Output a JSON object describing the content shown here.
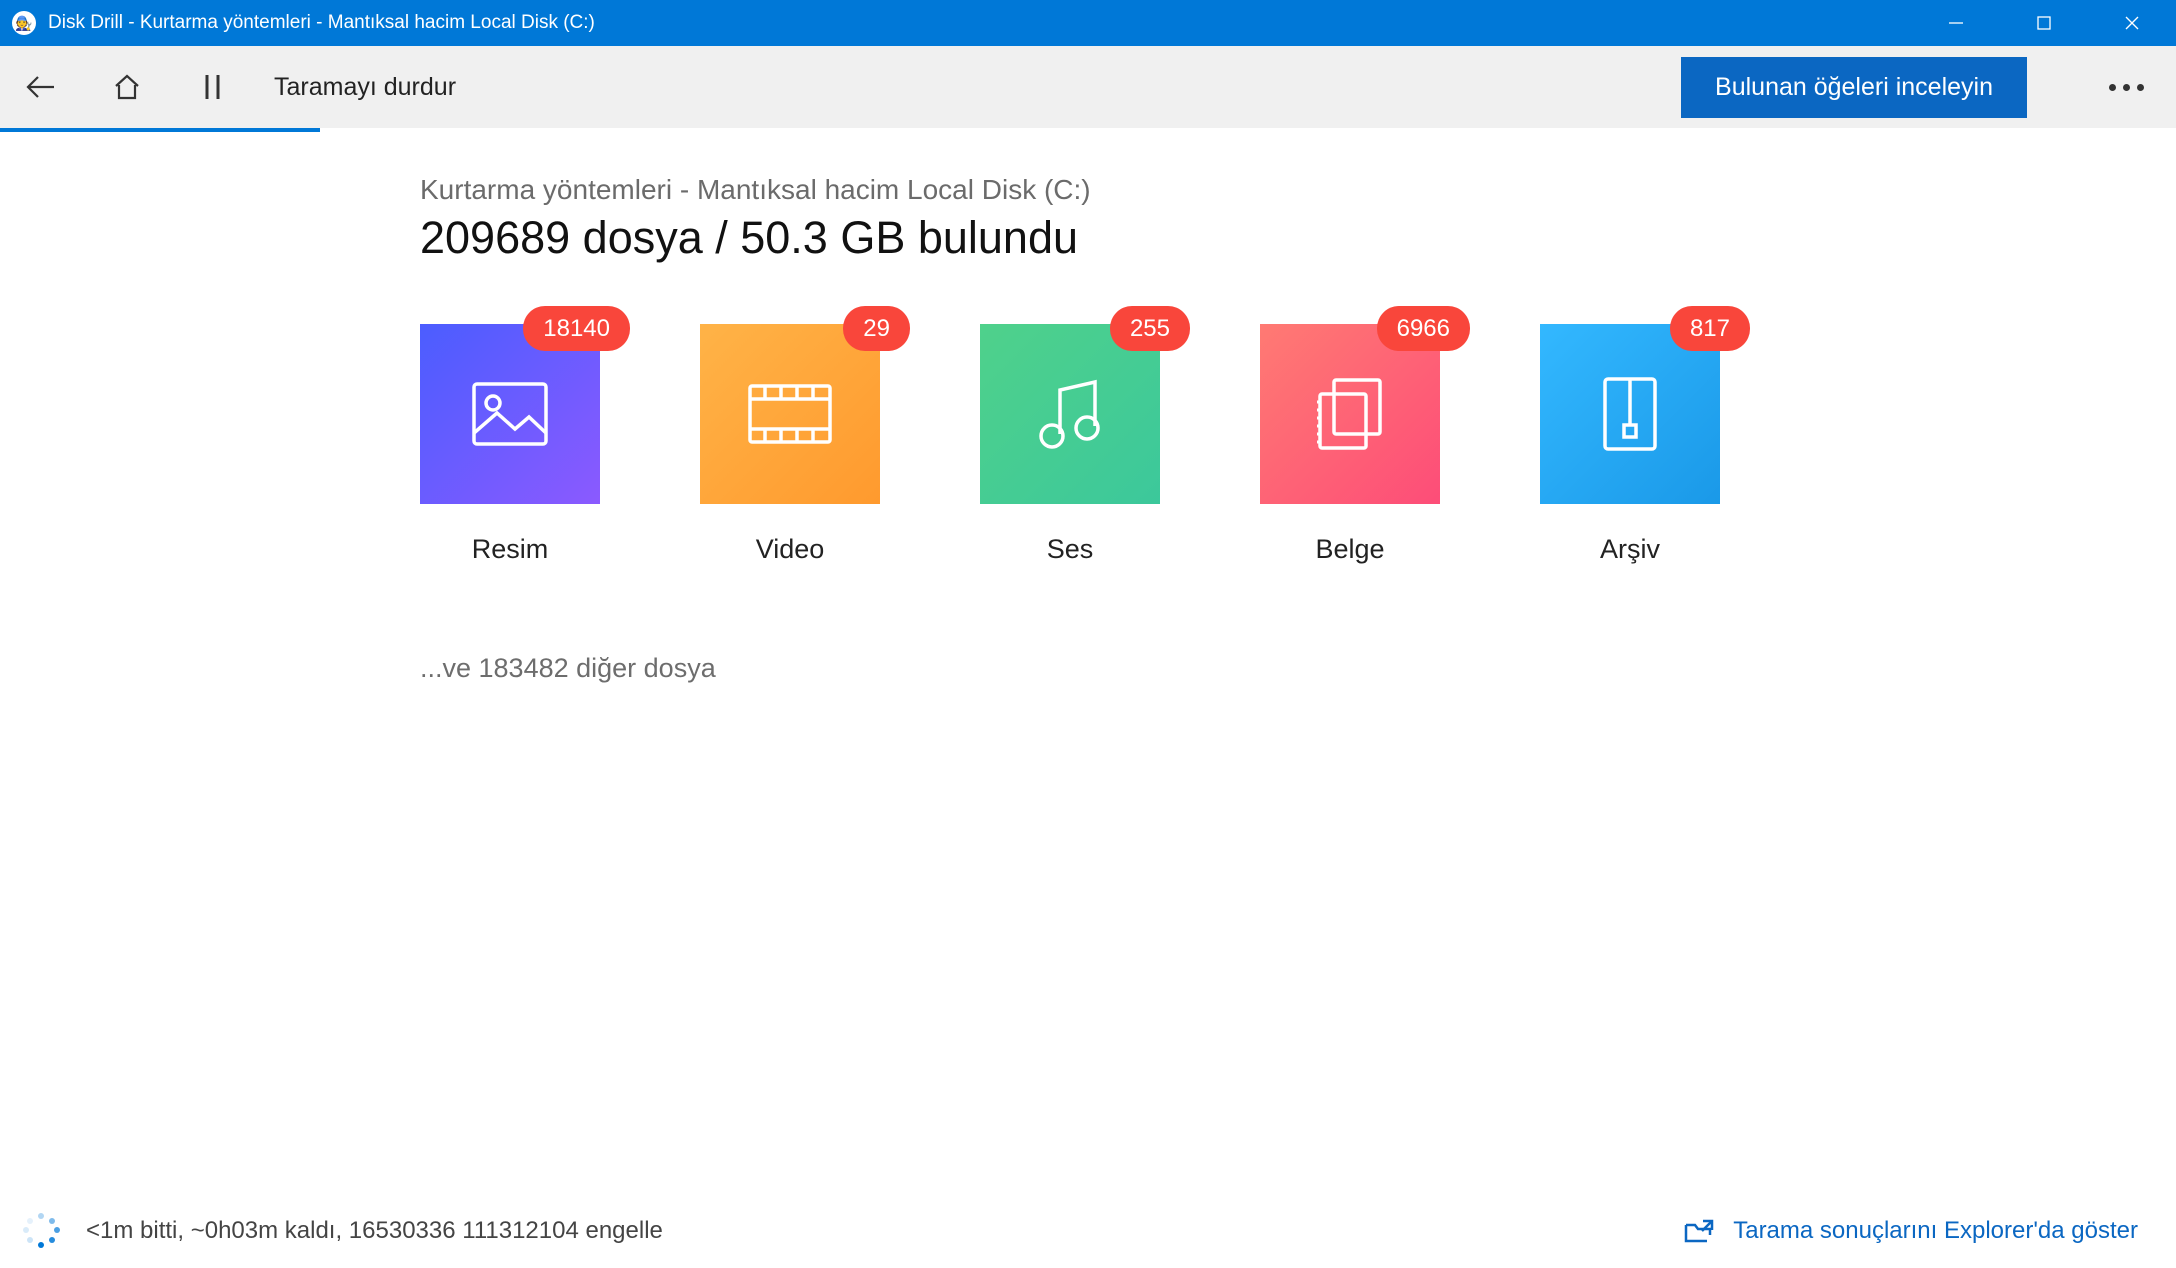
{
  "window": {
    "title": "Disk Drill - Kurtarma yöntemleri - Mantıksal hacim Local Disk (C:)"
  },
  "toolbar": {
    "stop_scan_label": "Taramayı durdur",
    "review_button_label": "Bulunan öğeleri inceleyin"
  },
  "main": {
    "breadcrumb": "Kurtarma yöntemleri - Mantıksal hacim Local Disk (C:)",
    "summary": "209689 dosya / 50.3 GB bulundu",
    "cards": [
      {
        "label": "Resim",
        "count": "18140",
        "kind": "image"
      },
      {
        "label": "Video",
        "count": "29",
        "kind": "video"
      },
      {
        "label": "Ses",
        "count": "255",
        "kind": "audio"
      },
      {
        "label": "Belge",
        "count": "6966",
        "kind": "doc"
      },
      {
        "label": "Arşiv",
        "count": "817",
        "kind": "arch"
      }
    ],
    "other_files": "...ve 183482 diğer dosya"
  },
  "status": {
    "text": "<1m bitti, ~0h03m kaldı, 16530336 111312104 engelle",
    "explorer_link": "Tarama sonuçlarını Explorer'da göster"
  }
}
